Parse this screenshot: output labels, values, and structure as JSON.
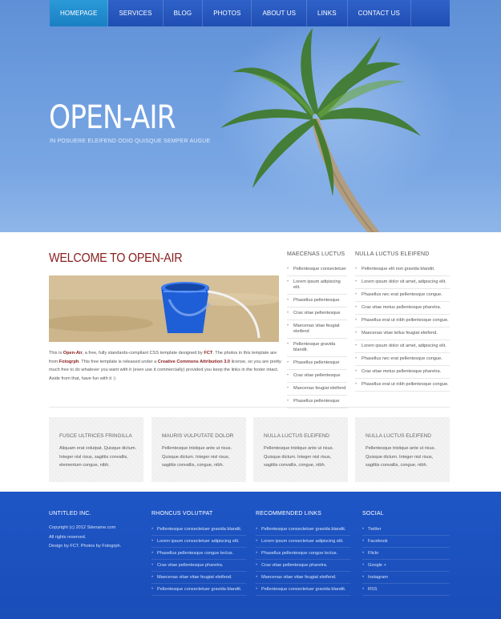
{
  "nav": {
    "items": [
      "HOMEPAGE",
      "SERVICES",
      "BLOG",
      "PHOTOS",
      "ABOUT US",
      "LINKS",
      "CONTACT US"
    ]
  },
  "hero": {
    "title": "OPEN-AIR",
    "tagline": "IN POSUERE ELEIFEND ODIO QUISQUE SEMPER AUGUE"
  },
  "welcome": {
    "title": "WELCOME TO OPEN-AIR",
    "text_1": "This is ",
    "hl_1": "Open-Air",
    "text_2": ", a free, fully standards-compliant CSS template designed by ",
    "hl_2": "FCT",
    "text_3": ". The photos in this template are from ",
    "hl_3": "Fotogrph",
    "text_4": ". This free template is released under a ",
    "hl_4": "Creative Commons Attribution 3.0",
    "text_5": " license, so you are pretty much free to do whatever you want with it (even use it commercially) provided you keep the links in the footer intact. Aside from that, have fun with it :)"
  },
  "column_1": {
    "title": "MAECENAS LUCTUS",
    "items": [
      "Pellentesque consectetuer",
      "Lorem ipsum adipiscing elit.",
      "Phasellus pellentesque",
      "Cras vitae pellentesque",
      "Maecenas vitae feugiat eleifend",
      "Pellentesque gravida blandit.",
      "Phasellus pellentesque",
      "Cras vitae pellentesque",
      "Maecenas feugiat eleifend",
      "Phasellus pellentesque"
    ]
  },
  "column_2": {
    "title": "NULLA LUCTUS ELEIFEND",
    "items": [
      "Pellentesque elit non gravida blandit.",
      "Lorem ipsum dolor sit amet, adipiscing elit.",
      "Phasellus nec erat pellentesque congue.",
      "Cras vitae metus pellentesque pharetra.",
      "Phasellus erat ut nibh pellentesque congue.",
      "Maecenas vitae tellus feugiat eleifend.",
      "Lorem ipsum dolor sit amet, adipiscing elit.",
      "Phasellus nec erat pellentesque congue.",
      "Cras vitae metus pellentesque pharetra.",
      "Phasellus erat ut nibh pellentesque congue."
    ]
  },
  "boxes": [
    {
      "title": "FUSCE ULTRICES FRINGILLA",
      "text": "Aliquam erat volutpat. Quisque dictum. Integer nisl risus, sagittis convallis, elementum congue, nibh."
    },
    {
      "title": "MAURIS VULPUTATE DOLOR",
      "text": "Pellentesque tristique ante ut risus. Quisque dictum. Integer nisl risus, sagittis convallis, congue, nibh."
    },
    {
      "title": "NULLA LUCTUS ELEIFEND",
      "text": "Pellentesque tristique ante ut risus. Quisque dictum. Integer nisl risus, sagittis convallis, congue, nibh."
    },
    {
      "title": "NULLA LUCTUS ELEIFEND",
      "text": "Pellentesque tristique ante ut risus. Quisque dictum. Integer nisl risus, sagittis convallis, congue, nibh."
    }
  ],
  "footer": {
    "company": {
      "title": "UNTITLED INC.",
      "lines": [
        "Copyright (c) 2012 Sitename.com",
        "All rights reserved.",
        "Design by FCT. Photos by Fotogrph."
      ]
    },
    "col_2": {
      "title": "RHONCUS VOLUTPAT",
      "items": [
        "Pellentesque consectetuer gravida blandit.",
        "Lorem ipsum consectetuer adipiscing elit.",
        "Phasellus pellentesque congue lectus.",
        "Cras vitae pellentesque pharetra.",
        "Maecenas vitae vitae feugiat eleifend.",
        "Pellentesque consectetuer gravida blandit."
      ]
    },
    "col_3": {
      "title": "RECOMMENDED LINKS",
      "items": [
        "Pellentesque consectetuer gravida blandit.",
        "Lorem ipsum consectetuer adipiscing elit.",
        "Phasellus pellentesque congue lectus.",
        "Cras vitae pellentesque pharetra.",
        "Maecenas vitae vitae feugiat eleifend.",
        "Pellentesque consectetuer gravida blandit."
      ]
    },
    "social": {
      "title": "SOCIAL",
      "items": [
        "Twitter",
        "Facebook",
        "Flickr",
        "Google +",
        "Instagram",
        "RSS"
      ]
    }
  }
}
